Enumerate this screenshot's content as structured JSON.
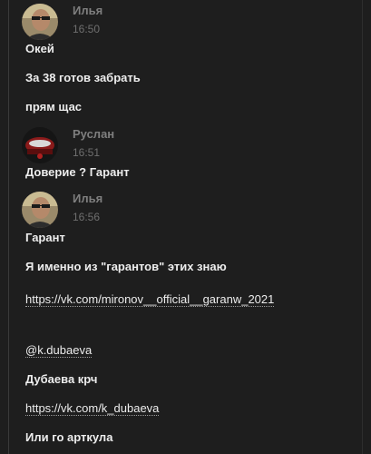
{
  "messages": [
    {
      "author": "Илья",
      "time": "16:50",
      "avatar": "ilya-avatar",
      "lines": [
        "Окей",
        "За 38 готов забрать",
        "прям щас"
      ]
    },
    {
      "author": "Руслан",
      "time": "16:51",
      "avatar": "ruslan-avatar",
      "lines": [
        "Доверие ? Гарант"
      ]
    },
    {
      "author": "Илья",
      "time": "16:56",
      "avatar": "ilya-avatar",
      "lines": [
        "Гарант",
        "Я именно из \"гарантов\" этих знаю",
        "https://vk.com/mironov__official__garanw_2021",
        "@k.dubaeva",
        "Дубаева крч",
        "https://vk.com/k_dubaeva",
        "Или го арткула"
      ]
    }
  ],
  "colors": {
    "background": "#1e1e1e",
    "author": "#7f7f7f",
    "time": "#6f6f6f",
    "text": "#ededed"
  }
}
